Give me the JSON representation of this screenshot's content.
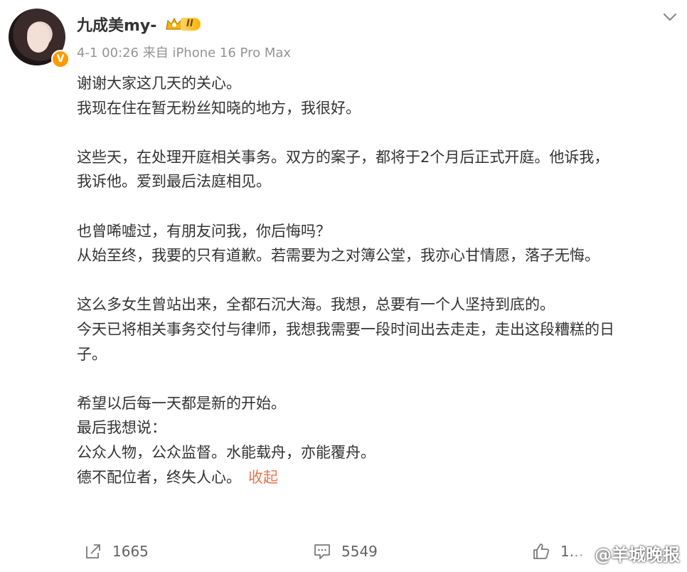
{
  "author": {
    "name": "九成美my-",
    "vip_level": "II",
    "verified_mark": "V"
  },
  "post": {
    "timestamp": "4-1 00:26 来自 iPhone 16 Pro Max",
    "paragraphs": [
      [
        "谢谢大家这几天的关心。",
        "我现在住在暂无粉丝知晓的地方，我很好。"
      ],
      [
        "这些天，在处理开庭相关事务。双方的案子，都将于2个月后正式开庭。他诉我，",
        "我诉他。爱到最后法庭相见。"
      ],
      [
        "也曾唏嘘过，有朋友问我，你后悔吗？",
        "从始至终，我要的只有道歉。若需要为之对簿公堂，我亦心甘情愿，落子无悔。"
      ],
      [
        "这么多女生曾站出来，全都石沉大海。我想，总要有一个人坚持到底的。",
        "今天已将相关事务交付与律师，我想我需要一段时间出去走走，走出这段糟糕的日",
        "子。"
      ],
      [
        "希望以后每一天都是新的开始。",
        "最后我想说：",
        "公众人物，公众监督。水能载舟，亦能覆舟。",
        "德不配位者，终失人心。"
      ]
    ],
    "collapse_label": "收起"
  },
  "actions": {
    "repost_count": "1665",
    "comment_count": "5549",
    "like_count": "1..."
  },
  "watermark": {
    "text": "@羊城晚报"
  },
  "icons": {
    "menu": "chevron-down-icon",
    "repost": "repost-icon",
    "comment": "comment-icon",
    "like": "thumbs-up-icon"
  },
  "colors": {
    "text": "#333333",
    "meta": "#939393",
    "link": "#eb7350",
    "verified": "#ff9a00"
  }
}
